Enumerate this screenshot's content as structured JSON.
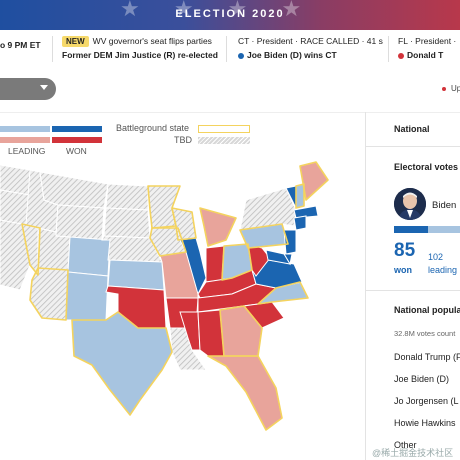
{
  "header": {
    "title": "ELECTION 2020"
  },
  "ticker": [
    {
      "line1": "",
      "line2": "o 9 PM ET"
    },
    {
      "badge": "NEW",
      "line1": "WV governor's seat flips parties",
      "line2": "Former DEM Jim Justice (R) re-elected"
    },
    {
      "line1": "CT · President · RACE CALLED · 41 s",
      "line2": "Joe Biden (D) wins CT",
      "dot_color": "#1b65b1"
    },
    {
      "line1": "FL · President · ",
      "line2": "Donald T",
      "dot_color": "#d2333a"
    }
  ],
  "toolbar": {
    "dropdown_value": "",
    "update_label": "Up"
  },
  "legend": {
    "leading": "LEADING",
    "won": "WON",
    "battleground": "Battleground state",
    "tbd": "TBD",
    "colors": {
      "dem_won": "#1b65b1",
      "dem_lead": "#a7c4e0",
      "rep_won": "#d2333a",
      "rep_lead": "#e8a49b",
      "battleground": "#f4d35e"
    }
  },
  "sidebar": {
    "title": "National",
    "electoral_title": "Electoral votes r",
    "candidate_name": "Biden",
    "won_value": "85",
    "won_label": "won",
    "leading_value": "102",
    "leading_label": "leading",
    "popular_title": "National popula",
    "votes_counted": "32.8M votes count",
    "rows": [
      "Donald Trump (F",
      "Joe Biden (D)",
      "Jo Jorgensen (L",
      "Howie Hawkins",
      "Other"
    ]
  },
  "map": {
    "states": [
      {
        "name": "WA",
        "status": "tbd"
      },
      {
        "name": "OR",
        "status": "tbd"
      },
      {
        "name": "CA",
        "status": "tbd"
      },
      {
        "name": "NV",
        "status": "tbd"
      },
      {
        "name": "ID",
        "status": "tbd"
      },
      {
        "name": "MT",
        "status": "tbd"
      },
      {
        "name": "WY",
        "status": "tbd"
      },
      {
        "name": "UT",
        "status": "tbd"
      },
      {
        "name": "AZ",
        "status": "tbd"
      },
      {
        "name": "CO",
        "status": "dem-lead"
      },
      {
        "name": "NM",
        "status": "dem-lead"
      },
      {
        "name": "ND",
        "status": "tbd"
      },
      {
        "name": "SD",
        "status": "tbd"
      },
      {
        "name": "NE",
        "status": "tbd"
      },
      {
        "name": "KS",
        "status": "dem-lead"
      },
      {
        "name": "OK",
        "status": "rep-won"
      },
      {
        "name": "TX",
        "status": "dem-lead"
      },
      {
        "name": "MN",
        "status": "tbd"
      },
      {
        "name": "IA",
        "status": "tbd"
      },
      {
        "name": "MO",
        "status": "rep-lead"
      },
      {
        "name": "AR",
        "status": "rep-won"
      },
      {
        "name": "LA",
        "status": "tbd"
      },
      {
        "name": "WI",
        "status": "tbd"
      },
      {
        "name": "IL",
        "status": "dem-won"
      },
      {
        "name": "MI",
        "status": "rep-lead"
      },
      {
        "name": "IN",
        "status": "rep-won"
      },
      {
        "name": "OH",
        "status": "dem-lead"
      },
      {
        "name": "KY",
        "status": "rep-won"
      },
      {
        "name": "TN",
        "status": "rep-won"
      },
      {
        "name": "MS",
        "status": "rep-won"
      },
      {
        "name": "AL",
        "status": "rep-won"
      },
      {
        "name": "GA",
        "status": "rep-lead"
      },
      {
        "name": "FL",
        "status": "rep-lead"
      },
      {
        "name": "SC",
        "status": "rep-won"
      },
      {
        "name": "NC",
        "status": "dem-lead"
      },
      {
        "name": "VA",
        "status": "dem-won"
      },
      {
        "name": "WV",
        "status": "rep-won"
      },
      {
        "name": "PA",
        "status": "dem-lead"
      },
      {
        "name": "NY",
        "status": "tbd"
      },
      {
        "name": "VT",
        "status": "dem-won"
      },
      {
        "name": "NH",
        "status": "dem-lead"
      },
      {
        "name": "ME",
        "status": "rep-lead"
      },
      {
        "name": "MA",
        "status": "dem-won"
      },
      {
        "name": "CT",
        "status": "dem-won"
      },
      {
        "name": "NJ",
        "status": "dem-won"
      },
      {
        "name": "DE",
        "status": "dem-won"
      },
      {
        "name": "MD",
        "status": "dem-won"
      }
    ]
  },
  "watermark": "@稀土掘金技术社区"
}
